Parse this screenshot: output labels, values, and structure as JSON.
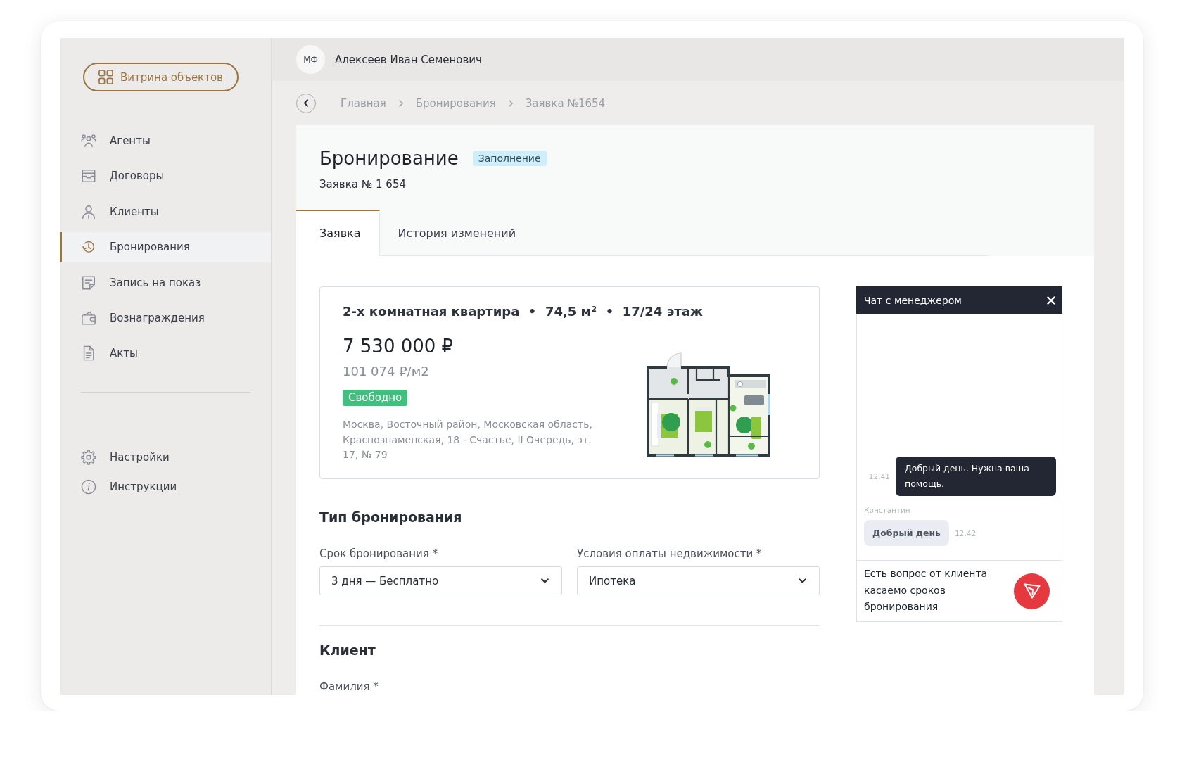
{
  "sidebar": {
    "showcase_button": "Витрина объектов",
    "items": [
      {
        "label": "Агенты",
        "selected": false
      },
      {
        "label": "Договоры",
        "selected": false
      },
      {
        "label": "Клиенты",
        "selected": false
      },
      {
        "label": "Бронирования",
        "selected": true
      },
      {
        "label": "Запись на показ",
        "selected": false
      },
      {
        "label": "Вознаграждения",
        "selected": false
      },
      {
        "label": "Акты",
        "selected": false
      }
    ],
    "footer_items": [
      {
        "label": "Настройки",
        "selected": false
      },
      {
        "label": "Инструкции",
        "selected": false
      }
    ]
  },
  "header": {
    "avatar_initials": "МФ",
    "user_name": "Алексеев Иван Семенович"
  },
  "breadcrumbs": [
    "Главная",
    "Бронирования",
    "Заявка №1654"
  ],
  "booking": {
    "title": "Бронирование",
    "status": "Заполнение",
    "request_number": "Заявка № 1 654"
  },
  "tabs": [
    {
      "label": "Заявка",
      "selected": true
    },
    {
      "label": "История изменений",
      "selected": false
    }
  ],
  "property": {
    "title": "2-х комнатная квартира  •  74,5 м²  •  17/24 этаж",
    "price": "7 530 000 ₽",
    "price_per_m2": "101 074 ₽/м2",
    "availability": "Свободно",
    "address": "Москва, Восточный район, Московская область, Краснознаменская, 18 - Счастье, II Очередь, эт. 17, № 79"
  },
  "booking_type": {
    "heading": "Тип бронирования",
    "fields": [
      {
        "label": "Срок бронирования *",
        "value": "3 дня — Бесплатно"
      },
      {
        "label": "Условия оплаты недвижимости *",
        "value": "Ипотека"
      }
    ]
  },
  "client": {
    "heading": "Клиент",
    "fields": [
      {
        "label": "Фамилия *"
      }
    ]
  },
  "chat": {
    "title": "Чат с менеджером",
    "messages": [
      {
        "kind": "outgoing",
        "text": "Добрый день. Нужна ваша помощь.",
        "time": "12:41"
      },
      {
        "kind": "incoming",
        "author": "Константин",
        "text": "Добрый день",
        "time": "12:42"
      }
    ],
    "draft": "Есть вопрос от клиента касаемо сроков бронирования"
  }
}
